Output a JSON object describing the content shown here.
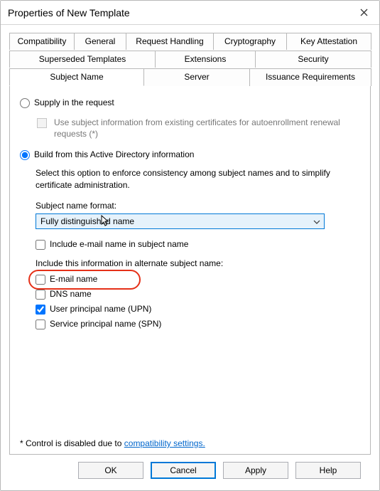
{
  "title": "Properties of New Template",
  "tabs": {
    "row1": [
      "Compatibility",
      "General",
      "Request Handling",
      "Cryptography",
      "Key Attestation"
    ],
    "row2": [
      "Superseded Templates",
      "Extensions",
      "Security"
    ],
    "row3": [
      "Subject Name",
      "Server",
      "Issuance Requirements"
    ],
    "active": "Subject Name"
  },
  "subject": {
    "supply_label": "Supply in the request",
    "supply_sub": "Use subject information from existing certificates for autoenrollment renewal requests (*)",
    "build_label": "Build from this Active Directory information",
    "build_desc": "Select this option to enforce consistency among subject names and to simplify certificate administration.",
    "snf_label": "Subject name format:",
    "snf_value": "Fully distinguished name",
    "include_email_sn": "Include e-mail name in subject name",
    "alt_header": "Include this information in alternate subject name:",
    "alt": {
      "email": "E-mail name",
      "dns": "DNS name",
      "upn": "User principal name (UPN)",
      "spn": "Service principal name (SPN)"
    },
    "selected_radio": "build",
    "checks": {
      "include_email_sn": false,
      "email": false,
      "dns": false,
      "upn": true,
      "spn": false
    }
  },
  "footnote_prefix": "* Control is disabled due to ",
  "footnote_link": "compatibility settings.",
  "buttons": {
    "ok": "OK",
    "cancel": "Cancel",
    "apply": "Apply",
    "help": "Help"
  }
}
